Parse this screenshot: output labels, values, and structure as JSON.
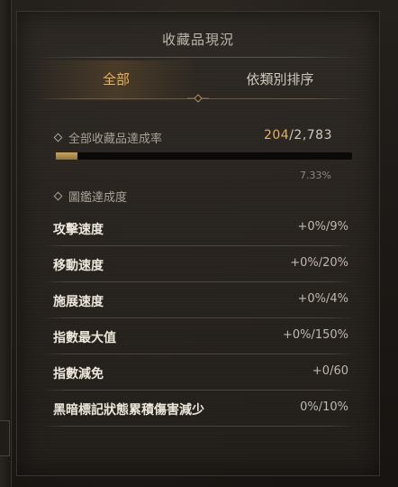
{
  "panel": {
    "title": "收藏品現況"
  },
  "tabs": [
    {
      "label": "全部",
      "active": true
    },
    {
      "label": "依類別排序",
      "active": false
    }
  ],
  "overall": {
    "label": "全部收藏品達成率",
    "current": "204",
    "separator": "/",
    "total": "2,783",
    "percent_text": "7.33%",
    "progress_fraction": 0.0733
  },
  "codex": {
    "label": "圖鑑達成度"
  },
  "stats": [
    {
      "label": "攻擊速度",
      "value": "+0%/9%"
    },
    {
      "label": "移動速度",
      "value": "+0%/20%"
    },
    {
      "label": "施展速度",
      "value": "+0%/4%"
    },
    {
      "label": "指數最大值",
      "value": "+0%/150%"
    },
    {
      "label": "指數減免",
      "value": "+0/60"
    },
    {
      "label": "黑暗標記狀態累積傷害減少",
      "value": "0%/10%"
    }
  ],
  "colors": {
    "accent_gold": "#e3b15c",
    "text_light": "#ece6db",
    "text_muted": "#a8a196"
  }
}
